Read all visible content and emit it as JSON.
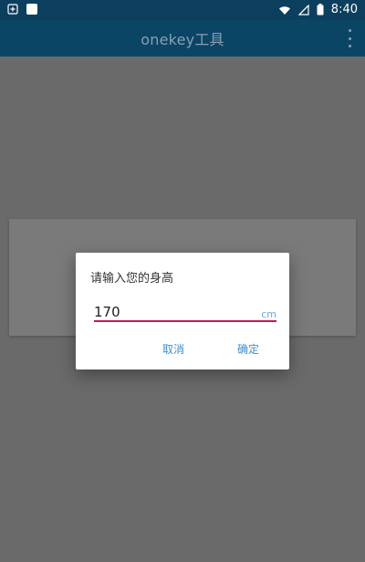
{
  "status_bar": {
    "time": "8:40",
    "left_icons": [
      "notification-icon",
      "app-icon"
    ],
    "right_icons": [
      "wifi-icon",
      "signal-icon",
      "battery-icon"
    ]
  },
  "app_bar": {
    "title": "onekey工具",
    "overflow_icon": "more-vert-icon"
  },
  "dialog": {
    "title": "请输入您的身高",
    "input_value": "170",
    "unit": "cm",
    "cancel_label": "取消",
    "ok_label": "确定",
    "accent_color": "#c2185b",
    "button_color": "#3b8fd0"
  },
  "colors": {
    "status_bar": "#0c3f5e",
    "app_bar": "#0b4566",
    "scrim": "#6b6b6b"
  }
}
